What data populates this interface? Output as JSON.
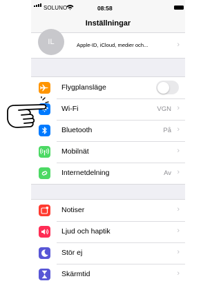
{
  "status_bar": {
    "carrier": "SOLUNO",
    "time": "08:58"
  },
  "nav": {
    "title": "Inställningar"
  },
  "profile": {
    "initials": "IL",
    "subtitle": "Apple-ID, iCloud, medier och..."
  },
  "group1": [
    {
      "label": "Flygplansläge",
      "value": "",
      "icon": "airplane-icon",
      "color": "#ff9500",
      "toggle_on": false
    },
    {
      "label": "Wi-Fi",
      "value": "VGN",
      "icon": "wifi-icon",
      "color": "#007aff"
    },
    {
      "label": "Bluetooth",
      "value": "På",
      "icon": "bluetooth-icon",
      "color": "#007aff"
    },
    {
      "label": "Mobilnät",
      "value": "",
      "icon": "antenna-icon",
      "color": "#4cd964"
    },
    {
      "label": "Internetdelning",
      "value": "Av",
      "icon": "hotspot-icon",
      "color": "#4cd964"
    }
  ],
  "group2": [
    {
      "label": "Notiser",
      "icon": "notifications-icon",
      "color": "#ff3b30"
    },
    {
      "label": "Ljud och haptik",
      "icon": "speaker-icon",
      "color": "#ff2d55"
    },
    {
      "label": "Stör ej",
      "icon": "moon-icon",
      "color": "#5856d6"
    },
    {
      "label": "Skärmtid",
      "icon": "hourglass-icon",
      "color": "#5856d6"
    }
  ],
  "chevron": "›"
}
